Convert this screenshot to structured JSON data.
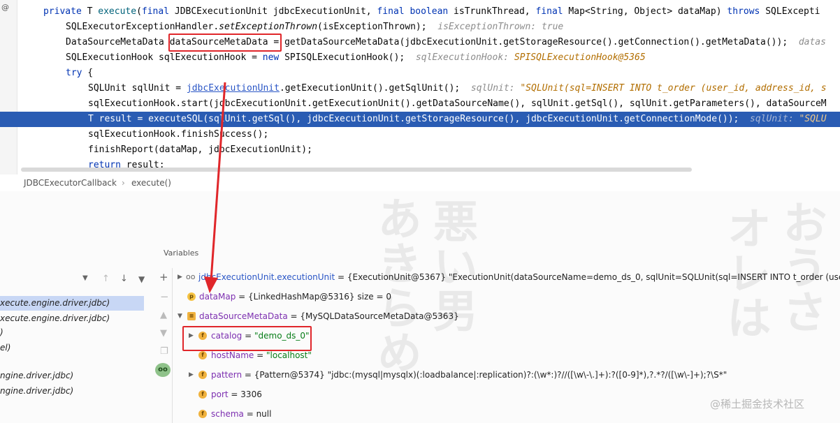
{
  "editor": {
    "lines": {
      "l1": {
        "kw_private": "private",
        "t1": " T ",
        "fn": "execute",
        "t2": "(",
        "kw_final1": "final",
        "t3": " JDBCExecutionUnit jdbcExecutionUnit, ",
        "kw_final2": "final",
        "t4": " ",
        "kw_boolean": "boolean",
        "t5": " isTrunkThread, ",
        "kw_final3": "final",
        "t6": " Map<String, Object> dataMap) ",
        "kw_throws": "throws",
        "t7": " SQLExcepti"
      },
      "l2": {
        "t1": "SQLExecutorExceptionHandler.",
        "method": "setExceptionThrown",
        "t2": "(isExceptionThrown);",
        "hint": "isExceptionThrown: true"
      },
      "l3": {
        "t1": "DataSourceMetaData ",
        "boxed": "dataSourceMetaData",
        "t2": " = getDataSourceMetaData(jdbcExecutionUnit.getStorageResource().getConnection().getMetaData());",
        "hint": "datas"
      },
      "l4": {
        "t1": "SQLExecutionHook sqlExecutionHook = ",
        "kw_new": "new",
        "t2": " SPISQLExecutionHook();",
        "hint": "sqlExecutionHook:",
        "hint_val": "SPISQLExecutionHook@5365"
      },
      "l5": {
        "kw_try": "try",
        "t1": " {"
      },
      "l6": {
        "t1": "SQLUnit sqlUnit = ",
        "link": "jdbcExecutionUnit",
        "t2": ".getExecutionUnit().getSqlUnit();",
        "hint": "sqlUnit:",
        "hint_val": "\"SQLUnit(sql=INSERT INTO t_order (user_id, address_id, s"
      },
      "l7": {
        "t1": "sqlExecutionHook.start(jdbcExecutionUnit.getExecutionUnit().getDataSourceName(), sqlUnit.getSql(), sqlUnit.getParameters(), dataSourceM"
      },
      "l8": {
        "t1": "T result = executeSQL(sqlUnit.getSql(), jdbcExecutionUnit.getStorageResource(), jdbcExecutionUnit.getConnectionMode());",
        "hint": "sqlUnit:",
        "hint_val": "\"SQLU"
      },
      "l9": {
        "t1": "sqlExecutionHook.finishSuccess();"
      },
      "l10": {
        "t1": "finishReport(dataMap, jdbcExecutionUnit);"
      },
      "l11": {
        "kw_return": "return",
        "t1": " result;"
      }
    }
  },
  "breadcrumb": {
    "class_name": "JDBCExecutorCallback",
    "sep": "›",
    "method": "execute()"
  },
  "debugger": {
    "variables_label": "Variables",
    "frames": [
      "xecute.engine.driver.jdbc)",
      "xecute.engine.driver.jdbc)",
      ")",
      "el)",
      "ngine.driver.jdbc)",
      "ngine.driver.jdbc)"
    ],
    "variables": [
      {
        "icon": "oo",
        "name": "jdbcExecutionUnit.executionUnit",
        "value": " = {ExecutionUnit@5367} \"ExecutionUnit(dataSourceName=demo_ds_0, sqlUnit=SQLUnit(sql=INSERT INTO t_order (user_id, ad"
      },
      {
        "icon": "p",
        "name": "dataMap",
        "value": " = {LinkedHashMap@5316}  size = 0"
      },
      {
        "icon": "list",
        "name": "dataSourceMetaData",
        "value": " = {MySQLDataSourceMetaData@5363}"
      },
      {
        "icon": "f",
        "name": "catalog",
        "value_prefix": " = ",
        "value_str": "\"demo_ds_0\""
      },
      {
        "icon": "f",
        "name": "hostName",
        "value_prefix": " = ",
        "value_str": "\"localhost\""
      },
      {
        "icon": "f",
        "name": "pattern",
        "value": " = {Pattern@5374} \"jdbc:(mysql|mysqlx)(:loadbalance|:replication)?:(\\w*:)?//([\\w\\-\\.]+):?([0-9]*),?.*?/([\\w\\-]+);?\\S*\""
      },
      {
        "icon": "f",
        "name": "port",
        "value": " = 3306"
      },
      {
        "icon": "f",
        "name": "schema",
        "value": " = null"
      }
    ]
  },
  "watermark_site": "@稀土掘金技术社区",
  "colors": {
    "selection": "#2a5cb3",
    "keyword": "#0033b3",
    "annotation_red": "#e0262a",
    "string_green": "#067d17"
  }
}
